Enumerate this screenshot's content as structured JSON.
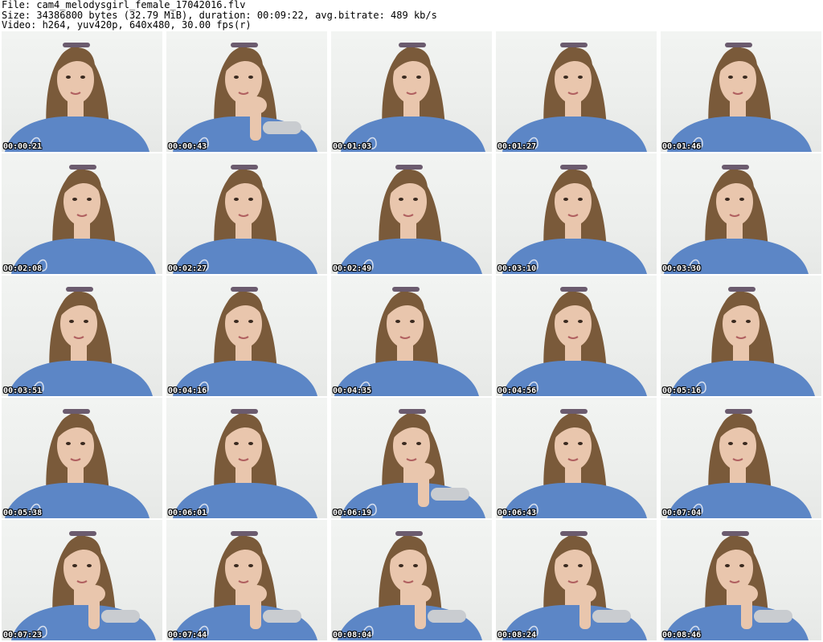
{
  "header": {
    "file_line": "File: cam4_melodysgirl_female_17042016.flv",
    "size_line": "Size: 34386800 bytes (32.79 MiB), duration: 00:09:22, avg.bitrate: 489 kb/s",
    "video_line": "Video: h264, yuv420p, 640x480, 30.00 fps(r)"
  },
  "colors": {
    "background": "#ffffff",
    "hair": "#7a5a3a",
    "skin": "#e9c6ad",
    "sweater": "#5c86c6",
    "wall": "#eef0ee"
  },
  "thumbnails": [
    {
      "time": "00:00:21",
      "hand": false
    },
    {
      "time": "00:00:43",
      "hand": true
    },
    {
      "time": "00:01:03",
      "hand": false
    },
    {
      "time": "00:01:27",
      "hand": false
    },
    {
      "time": "00:01:46",
      "hand": false
    },
    {
      "time": "00:02:08",
      "hand": false
    },
    {
      "time": "00:02:27",
      "hand": false
    },
    {
      "time": "00:02:49",
      "hand": false
    },
    {
      "time": "00:03:10",
      "hand": false
    },
    {
      "time": "00:03:30",
      "hand": false
    },
    {
      "time": "00:03:51",
      "hand": false
    },
    {
      "time": "00:04:16",
      "hand": false
    },
    {
      "time": "00:04:35",
      "hand": false
    },
    {
      "time": "00:04:56",
      "hand": false
    },
    {
      "time": "00:05:16",
      "hand": false
    },
    {
      "time": "00:05:38",
      "hand": false
    },
    {
      "time": "00:06:01",
      "hand": false
    },
    {
      "time": "00:06:19",
      "hand": true
    },
    {
      "time": "00:06:43",
      "hand": false
    },
    {
      "time": "00:07:04",
      "hand": false
    },
    {
      "time": "00:07:23",
      "hand": true
    },
    {
      "time": "00:07:44",
      "hand": true
    },
    {
      "time": "00:08:04",
      "hand": true
    },
    {
      "time": "00:08:24",
      "hand": true
    },
    {
      "time": "00:08:46",
      "hand": true
    }
  ]
}
